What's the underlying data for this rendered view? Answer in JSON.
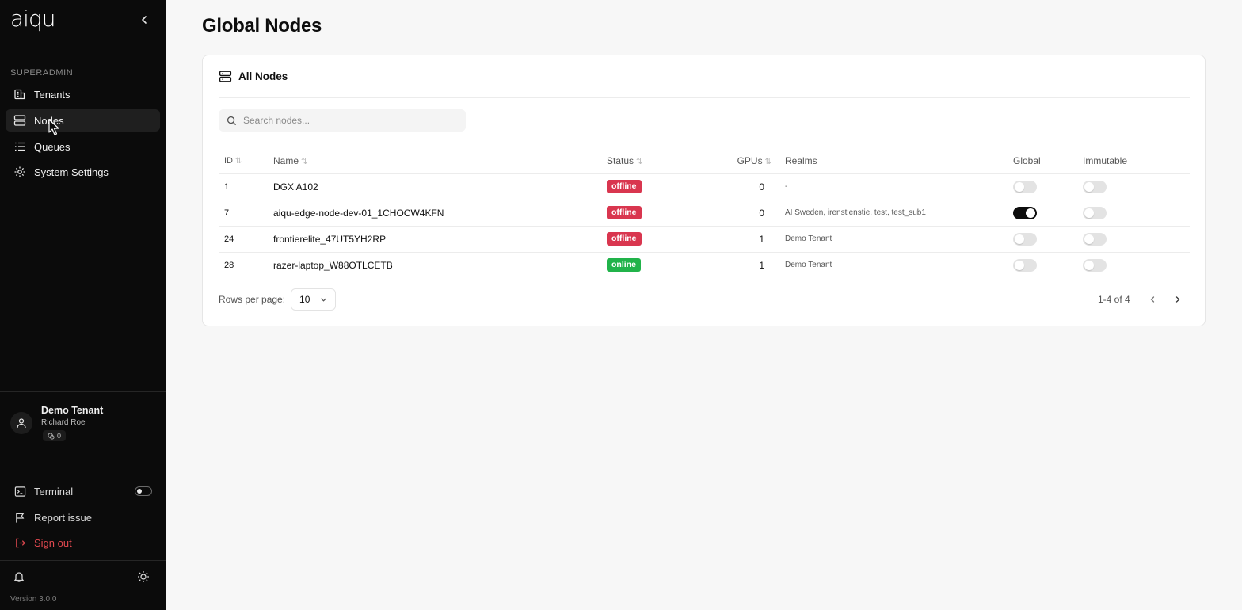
{
  "app": {
    "logo": "aiqu",
    "version": "Version 3.0.0"
  },
  "sidebar": {
    "section_label": "SUPERADMIN",
    "items": [
      {
        "label": "Tenants",
        "icon": "building-icon"
      },
      {
        "label": "Nodes",
        "icon": "server-icon",
        "active": true
      },
      {
        "label": "Queues",
        "icon": "list-icon"
      },
      {
        "label": "System Settings",
        "icon": "gear-icon"
      }
    ],
    "user": {
      "tenant": "Demo Tenant",
      "name": "Richard Roe",
      "badge_count": "0"
    },
    "bottom": {
      "terminal": "Terminal",
      "report": "Report issue",
      "signout": "Sign out"
    }
  },
  "page": {
    "title": "Global Nodes"
  },
  "card": {
    "title": "All Nodes",
    "search_placeholder": "Search nodes..."
  },
  "table": {
    "headers": {
      "id": "ID",
      "name": "Name",
      "status": "Status",
      "gpus": "GPUs",
      "realms": "Realms",
      "global": "Global",
      "immutable": "Immutable"
    },
    "rows": [
      {
        "id": "1",
        "name": "DGX A102",
        "status": "offline",
        "gpus": "0",
        "realms": "-",
        "global": false,
        "immutable": false
      },
      {
        "id": "7",
        "name": "aiqu-edge-node-dev-01_1CHOCW4KFN",
        "status": "offline",
        "gpus": "0",
        "realms": "AI Sweden, irenstienstie, test, test_sub1",
        "global": true,
        "immutable": false
      },
      {
        "id": "24",
        "name": "frontierelite_47UT5YH2RP",
        "status": "offline",
        "gpus": "1",
        "realms": "Demo Tenant",
        "global": false,
        "immutable": false
      },
      {
        "id": "28",
        "name": "razer-laptop_W88OTLCETB",
        "status": "online",
        "gpus": "1",
        "realms": "Demo Tenant",
        "global": false,
        "immutable": false
      }
    ]
  },
  "pagination": {
    "rows_per_page_label": "Rows per page:",
    "rows_per_page": "10",
    "range": "1-4 of 4"
  },
  "colors": {
    "offline": "#d9364f",
    "online": "#21b34a",
    "sidebar_bg": "#0b0b0b",
    "signout": "#e0484f"
  }
}
